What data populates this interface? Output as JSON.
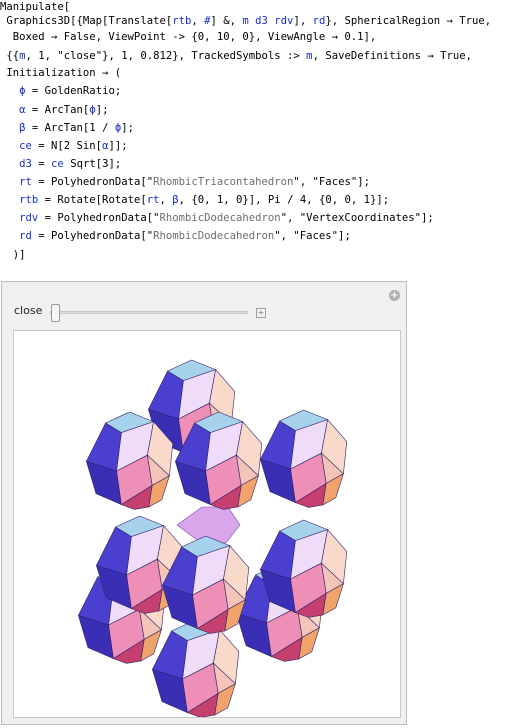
{
  "code": {
    "l0": "Manipulate[",
    "l1a": " Graphics3D[{Map[Translate[",
    "l1b": "rtb",
    "l1c": ", ",
    "l1d": "#",
    "l1e": "] &, ",
    "l1f": "m d3 rdv",
    "l1g": "], ",
    "l1h": "rd",
    "l1i": "}, SphericalRegion → True,",
    "l2": "  Boxed → False, ViewPoint -> {0, 10, 0}, ViewAngle → 0.1],",
    "l3a": " {{",
    "l3b": "m",
    "l3c": ", 1, \"close\"}, 1, 0.812}, TrackedSymbols :> ",
    "l3d": "m",
    "l3e": ", SaveDefinitions → True,",
    "l4": " Initialization → (",
    "l5a": "   ",
    "l5b": "ϕ",
    "l5c": " = GoldenRatio;",
    "l6a": "   ",
    "l6b": "α",
    "l6c": " = ArcTan[",
    "l6d": "ϕ",
    "l6e": "];",
    "l7a": "   ",
    "l7b": "β",
    "l7c": " = ArcTan[1 / ",
    "l7d": "ϕ",
    "l7e": "];",
    "l8a": "   ",
    "l8b": "ce",
    "l8c": " = N[2 Sin[",
    "l8d": "α",
    "l8e": "]];",
    "l9a": "   ",
    "l9b": "d3",
    "l9c": " = ",
    "l9d": "ce",
    "l9e": " Sqrt[3];",
    "l10a": "   ",
    "l10b": "rt",
    "l10c": " = PolyhedronData[\"",
    "l10d": "RhombicTriacontahedron",
    "l10e": "\", \"Faces\"];",
    "l11a": "   ",
    "l11b": "rtb",
    "l11c": " = Rotate[Rotate[",
    "l11d": "rt",
    "l11e": ", ",
    "l11f": "β",
    "l11g": ", {0, 1, 0}], Pi / 4, {0, 0, 1}];",
    "l12a": "   ",
    "l12b": "rdv",
    "l12c": " = PolyhedronData[\"",
    "l12d": "RhombicDodecahedron",
    "l12e": "\", \"VertexCoordinates\"];",
    "l13a": "   ",
    "l13b": "rd",
    "l13c": " = PolyhedronData[\"",
    "l13d": "RhombicDodecahedron",
    "l13e": "\", \"Faces\"];",
    "l14": "  )]"
  },
  "manipulate": {
    "control_label": "close",
    "slider_value": 1,
    "slider_min": 1,
    "slider_max": 0.812,
    "plus_icon": "plus-circle-icon",
    "slider_plus_icon": "plus-icon"
  },
  "colors": {
    "blue": "#4b3fcf",
    "pink": "#ee8fb8",
    "magenta": "#c5406e",
    "lavender": "#eedcf8",
    "light_blue": "#a6d2ee",
    "peach": "#f9d9c9",
    "orange": "#f0a46c",
    "center": "#d9a6ec"
  }
}
